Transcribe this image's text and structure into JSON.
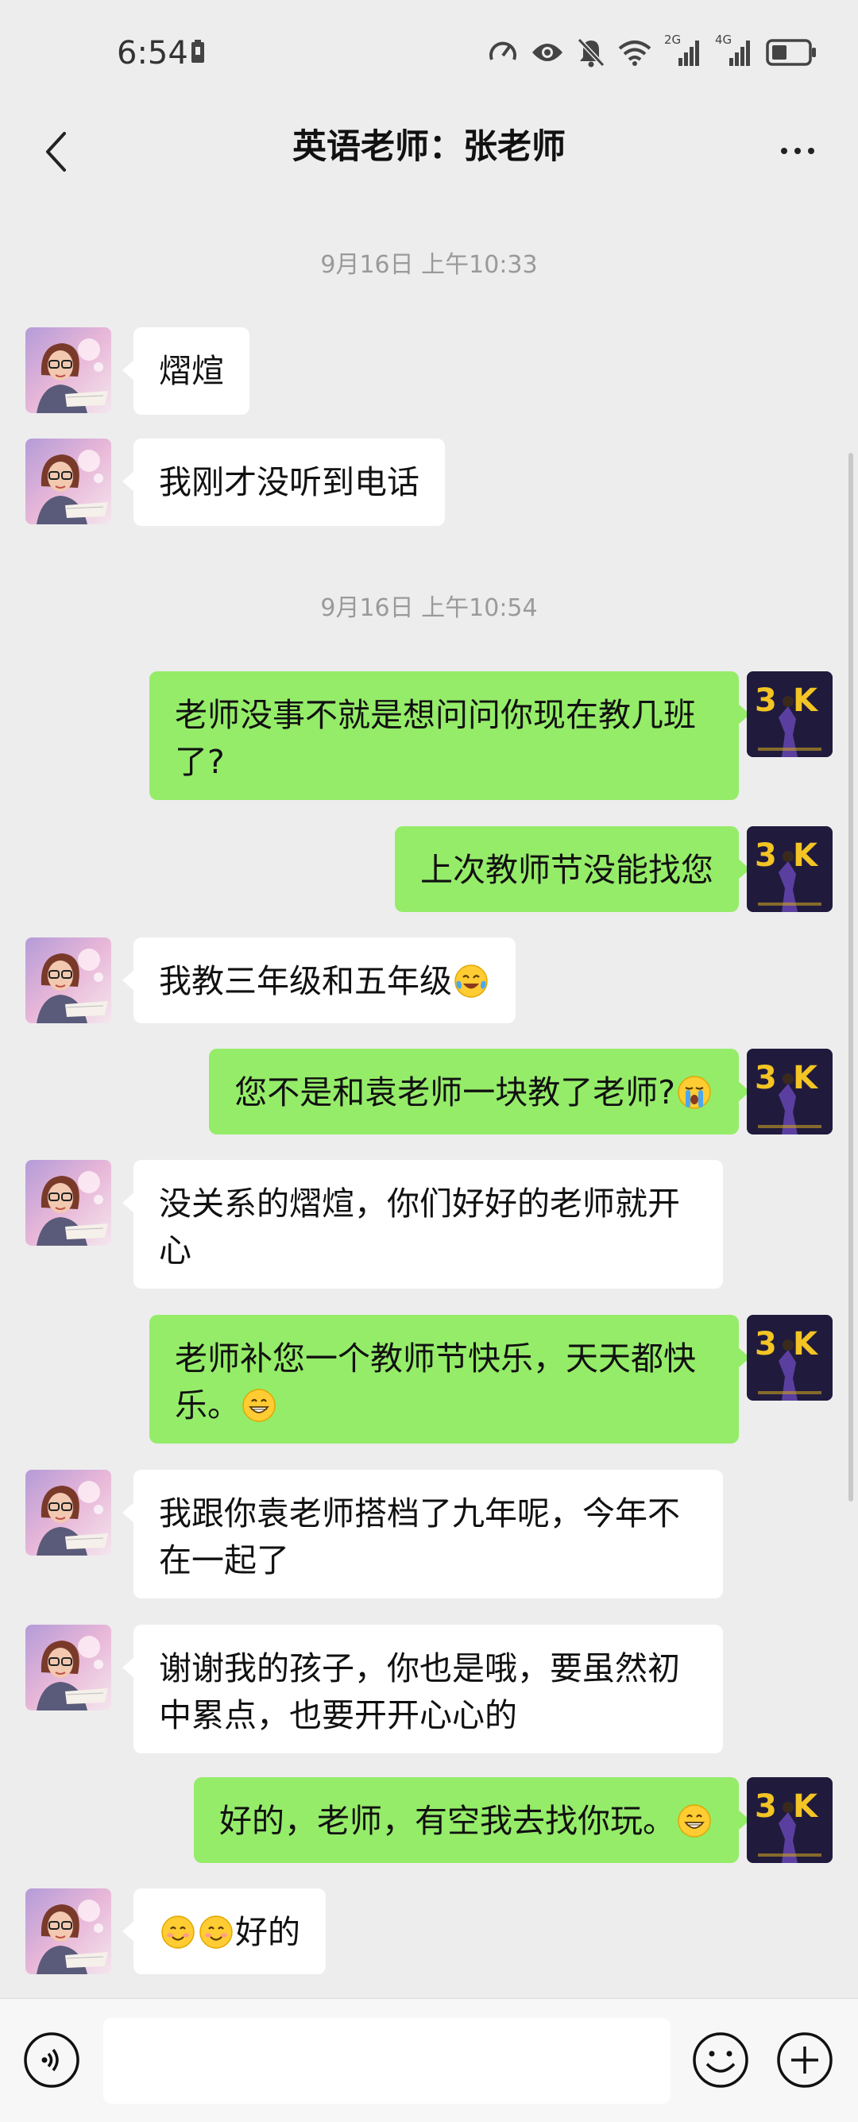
{
  "status_bar": {
    "time": "6:54",
    "signal_2g_label": "2G",
    "signal_4g_label": "4G"
  },
  "nav": {
    "title": "英语老师：张老师",
    "back_icon": "chevron-left-icon",
    "more_icon": "more-dots-icon"
  },
  "chat": {
    "timestamps": [
      "9月16日 上午10:33",
      "9月16日 上午10:54"
    ],
    "messages": [
      {
        "from": "teacher",
        "text": "熠煊"
      },
      {
        "from": "teacher",
        "text": "我刚才没听到电话"
      },
      {
        "from": "me",
        "text": "老师没事不就是想问问你现在教几班了?"
      },
      {
        "from": "me",
        "text": "上次教师节没能找您"
      },
      {
        "from": "teacher",
        "text": "我教三年级和五年级",
        "emoji_after": "tears-of-joy"
      },
      {
        "from": "me",
        "text": "您不是和袁老师一块教了老师?",
        "emoji_after": "crying"
      },
      {
        "from": "teacher",
        "text": "没关系的熠煊，你们好好的老师就开心"
      },
      {
        "from": "me",
        "text": "老师补您一个教师节快乐，天天都快乐。",
        "emoji_after": "grin"
      },
      {
        "from": "teacher",
        "text": "我跟你袁老师搭档了九年呢，今年不在一起了"
      },
      {
        "from": "teacher",
        "text": "谢谢我的孩子，你也是哦，要虽然初中累点，也要开开心心的"
      },
      {
        "from": "me",
        "text": "好的，老师，有空我去找你玩。",
        "emoji_after": "grin"
      },
      {
        "from": "teacher",
        "text": "好的",
        "emoji_before": [
          "smile",
          "smile"
        ]
      }
    ],
    "my_avatar_text": "3K"
  },
  "input_bar": {
    "voice_icon": "voice-icon",
    "emoji_icon": "emoji-icon",
    "plus_icon": "plus-icon",
    "placeholder": ""
  }
}
